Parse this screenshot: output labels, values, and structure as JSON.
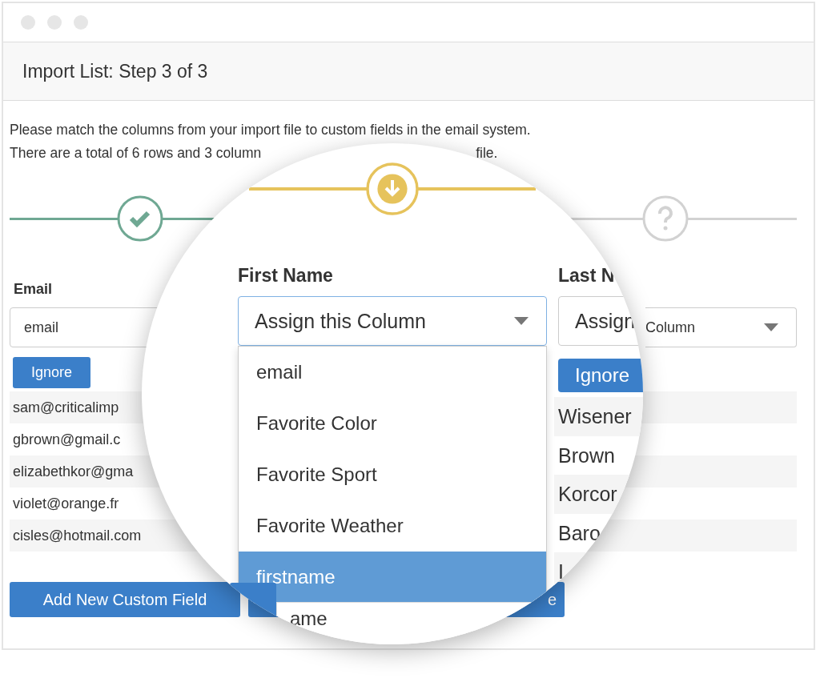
{
  "window": {
    "title": "Import List: Step 3 of 3"
  },
  "intro": {
    "line_1": "Please match the columns from your import file to custom fields in the email system.",
    "line_2": "There are a total of 6 rows and 3 column",
    "line_2_tail": "file."
  },
  "steps": [
    {
      "kind": "done"
    },
    {
      "kind": "pending"
    }
  ],
  "columns": [
    {
      "header": "Email",
      "value": "email",
      "button": "Ignore",
      "cells": [
        "sam@criticalimp",
        "gbrown@gmail.c",
        "elizabethkor@gma",
        "violet@orange.fr",
        "cisles@hotmail.com"
      ]
    },
    {
      "value": "Column"
    }
  ],
  "buttons": [
    {
      "label": "Add New Custom Field"
    },
    {
      "label": "e"
    }
  ],
  "magnifier": {
    "step": {
      "kind": "current"
    },
    "column": {
      "header": "First Name",
      "value": "Assign this Column",
      "options": [
        {
          "label": "email",
          "selected": false
        },
        {
          "label": "Favorite Color",
          "selected": false
        },
        {
          "label": "Favorite Sport",
          "selected": false
        },
        {
          "label": "Favorite Weather",
          "selected": false
        },
        {
          "label": "firstname",
          "selected": true
        }
      ],
      "tail_option": "ame"
    },
    "side_column": {
      "header": "Last N",
      "value": "Assign",
      "button": "Ignore",
      "cells": [
        "Wisener",
        "Brown",
        "Korcor",
        "Baro",
        "I"
      ]
    }
  }
}
